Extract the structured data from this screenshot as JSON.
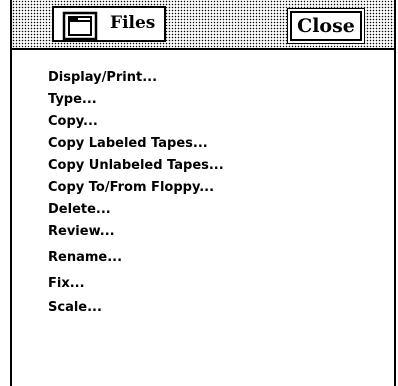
{
  "window": {
    "title": "Files",
    "title_icon": "folder-icon",
    "close_label": "Close"
  },
  "menu": {
    "items": [
      "Display/Print...",
      "Type...",
      "Copy...",
      "Copy Labeled Tapes...",
      "Copy Unlabeled Tapes...",
      "Copy To/From Floppy...",
      "Delete...",
      "Review...",
      "Rename...",
      "Fix...",
      "Scale..."
    ]
  }
}
